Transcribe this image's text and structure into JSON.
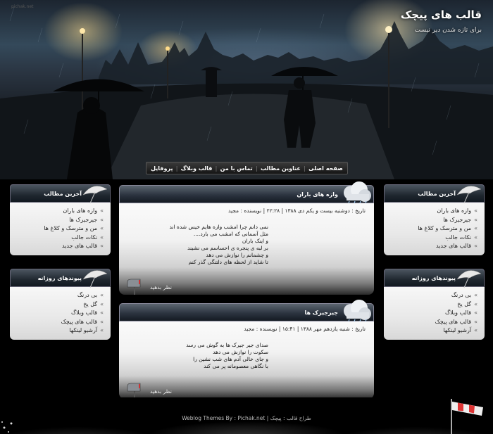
{
  "header": {
    "site_title": "قالب های پیچک",
    "subtitle": "برای تازه شدن دیر نیست",
    "watermark": "pichak.net"
  },
  "nav": {
    "items": [
      "صفحه اصلی",
      "عناوین مطالب",
      "تماس با من",
      "قالب وبلاگ",
      "پروفایل"
    ],
    "separator": "|"
  },
  "left_sidebar": {
    "recent_posts": {
      "title": "آخرین مطالب",
      "items": [
        "وازه های باران",
        "جیرجیرک ها",
        "من و مترسک و کلاغ ها",
        "نکات جالب",
        "قالب های جدید"
      ]
    },
    "daily_links": {
      "title": "پیوندهای روزانه",
      "items": [
        "بی درنگ",
        "گل یخ",
        "قالب وبلاگ",
        "قالب های پیچک",
        "آرشیو لینکها"
      ]
    }
  },
  "right_sidebar": {
    "recent_posts": {
      "title": "آخرین مطالب",
      "items": [
        "وازه های باران",
        "جیرجیرک ها",
        "من و مترسک و کلاغ ها",
        "نکات جالب",
        "قالب های جدید"
      ]
    },
    "daily_links": {
      "title": "پیوندهای روزانه",
      "items": [
        "بی درنگ",
        "گل یخ",
        "قالب وبلاگ",
        "قالب های پیچک",
        "آرشیو لینکها"
      ]
    }
  },
  "posts": [
    {
      "title": "وازه های باران",
      "meta": "تاریخ : دوشنبه بیست و یکم دی ۱۳۸۸ | ۲۲:۲۸ | نویسنده : مجید",
      "lines": [
        "نمی دانم چرا امشب وازه هایم خیس شده اند",
        "مثل آسمانی که امشب می بارد....",
        "و اینک باران",
        "بر لبه ی پنجره ی احساسم می نشیند",
        "و چشمانم را نوازش می دهد",
        "تا شاید از لحظه های دلتنگی گذر کنم"
      ],
      "comment_label": "نظر بدهید"
    },
    {
      "title": "جیرجیرک ها",
      "meta": "تاریخ : شنبه یازدهم مهر ۱۳۸۸ | ۱۵:۴۱ | نویسنده : مجید",
      "lines": [
        "صدای جیر جیرک ها به گوش می رسد",
        "سکوت را نوازش می دهد",
        "و جای خالی آدم های شب نشین را",
        "با نگاهی معصومانه پر می کند"
      ],
      "comment_label": "نظر بدهید"
    }
  ],
  "footer": {
    "credits": "Weblog Themes By : Pichak.net | طراح قالب : پیچک"
  },
  "colors": {
    "background": "#000000",
    "header_bar": "#2c3440",
    "panel": "#f2f2f2"
  }
}
